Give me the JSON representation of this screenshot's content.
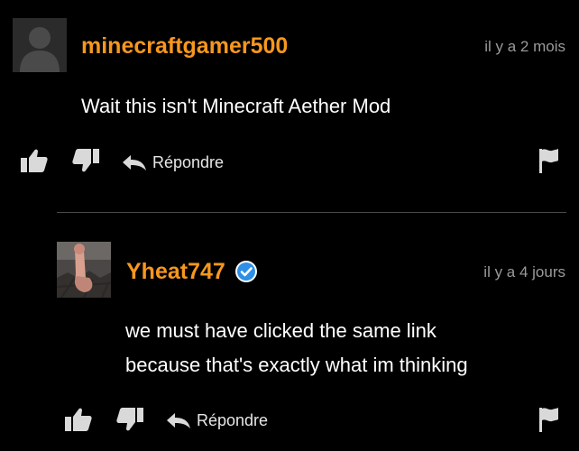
{
  "colors": {
    "background": "#000000",
    "username": "#f7971e",
    "timestamp": "#9a9a9a",
    "text": "#ffffff",
    "icon": "#d9d9d9",
    "verified": "#2e8fe6"
  },
  "comments": [
    {
      "username": "minecraftgamer500",
      "timestamp": "il y a 2 mois",
      "text": "Wait this isn't Minecraft Aether Mod",
      "reply_label": "Répondre",
      "verified": false,
      "avatar": "default-avatar"
    },
    {
      "username": "Yheat747",
      "timestamp": "il y a 4 jours",
      "text_lines": [
        "we must have clicked the same link",
        "because that's exactly what im thinking"
      ],
      "reply_label": "Répondre",
      "verified": true,
      "avatar": "photo-avatar"
    }
  ],
  "icons": {
    "like": "thumbs-up-icon",
    "dislike": "thumbs-down-icon",
    "reply": "reply-arrow-icon",
    "flag": "flag-icon",
    "verified": "verified-check-icon"
  }
}
